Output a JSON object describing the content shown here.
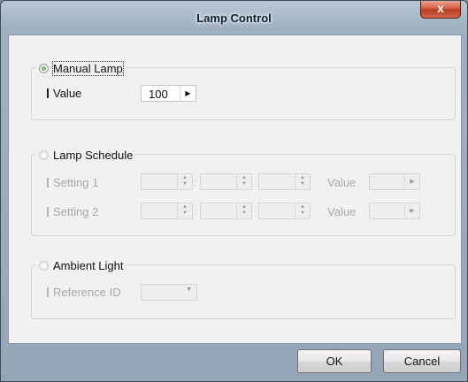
{
  "window": {
    "title": "Lamp Control",
    "close_label": "x"
  },
  "manual": {
    "label": "Manual Lamp",
    "value_label": "Value",
    "value": "100",
    "arrow": "▶"
  },
  "schedule": {
    "label": "Lamp Schedule",
    "rows": [
      {
        "label": "Setting 1",
        "value_label": "Value"
      },
      {
        "label": "Setting 2",
        "value_label": "Value"
      }
    ],
    "separator": ":"
  },
  "ambient": {
    "label": "Ambient Light",
    "reference_label": "Reference ID"
  },
  "buttons": {
    "ok": "OK",
    "cancel": "Cancel"
  }
}
